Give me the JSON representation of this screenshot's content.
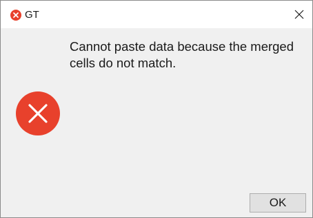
{
  "window": {
    "title": "GT",
    "title_icon": "error-icon",
    "close_icon": "close-icon"
  },
  "message": {
    "icon": "error-icon",
    "text": "Cannot paste data because the merged cells do not match."
  },
  "buttons": {
    "ok_label": "OK"
  },
  "colors": {
    "error_red": "#e8412c",
    "dialog_background": "#f0f0f0",
    "titlebar_background": "#ffffff"
  }
}
